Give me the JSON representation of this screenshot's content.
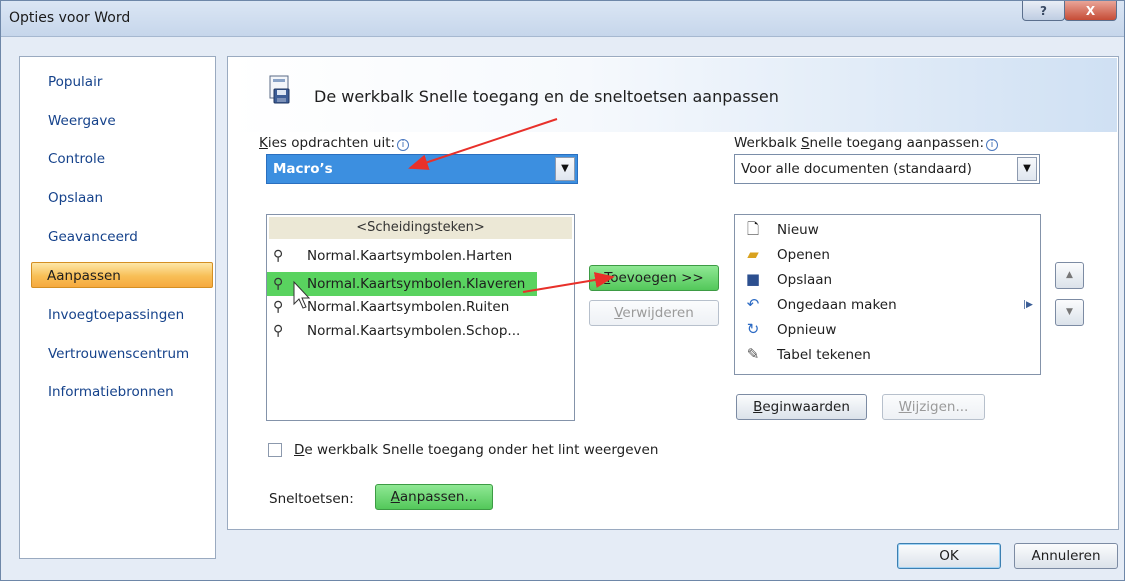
{
  "window": {
    "title": "Opties voor Word",
    "help_label": "?",
    "close_label": "X"
  },
  "nav": {
    "items": [
      {
        "label": "Populair"
      },
      {
        "label": "Weergave"
      },
      {
        "label": "Controle"
      },
      {
        "label": "Opslaan"
      },
      {
        "label": "Geavanceerd"
      },
      {
        "label": "Aanpassen",
        "selected": true
      },
      {
        "label": "Invoegtoepassingen"
      },
      {
        "label": "Vertrouwenscentrum"
      },
      {
        "label": "Informatiebronnen"
      }
    ]
  },
  "header": {
    "title": "De werkbalk Snelle toegang en de sneltoetsen aanpassen"
  },
  "choose_commands": {
    "label_prefix": "K",
    "label_rest": "ies opdrachten uit:",
    "info_icon": "i",
    "selected": "Macro’s",
    "list": {
      "separator": "<Scheidingsteken>",
      "items": [
        "Normal.Kaartsymbolen.Harten",
        "Normal.Kaartsymbolen.Klaveren",
        "Normal.Kaartsymbolen.Ruiten",
        "Normal.Kaartsymbolen.Schop..."
      ]
    }
  },
  "qat": {
    "label_before": "Werkbalk ",
    "label_u": "S",
    "label_after": "nelle toegang aanpassen:",
    "info_icon": "i",
    "selected": "Voor alle documenten (standaard)",
    "items": [
      {
        "label": "Nieuw",
        "icon": "new-document-icon"
      },
      {
        "label": "Openen",
        "icon": "open-folder-icon"
      },
      {
        "label": "Opslaan",
        "icon": "save-disk-icon"
      },
      {
        "label": "Ongedaan maken",
        "icon": "undo-icon"
      },
      {
        "label": "Opnieuw",
        "icon": "redo-icon"
      },
      {
        "label": "Tabel tekenen",
        "icon": "draw-table-icon"
      }
    ]
  },
  "buttons": {
    "add_u": "T",
    "add_rest": "oevoegen >>",
    "remove_u": "V",
    "remove_rest": "erwijderen",
    "reset_u": "B",
    "reset_rest": "eginwaarden",
    "modify_u": "W",
    "modify_rest": "ijzigen...",
    "up": "▲",
    "down": "▼",
    "ok": "OK",
    "cancel": "Annuleren"
  },
  "show_below_ribbon": {
    "checked": false,
    "label_u": "D",
    "label_rest": "e werkbalk Snelle toegang onder het lint weergeven"
  },
  "shortcuts": {
    "label": "Sneltoetsen:",
    "button_u": "A",
    "button_rest": "anpassen..."
  },
  "colors": {
    "highlight_green": "#59d35f",
    "selected_combo": "#3c8fe0",
    "annotation_arrow": "#e8302a",
    "nav_selected": "#f8bf56"
  }
}
